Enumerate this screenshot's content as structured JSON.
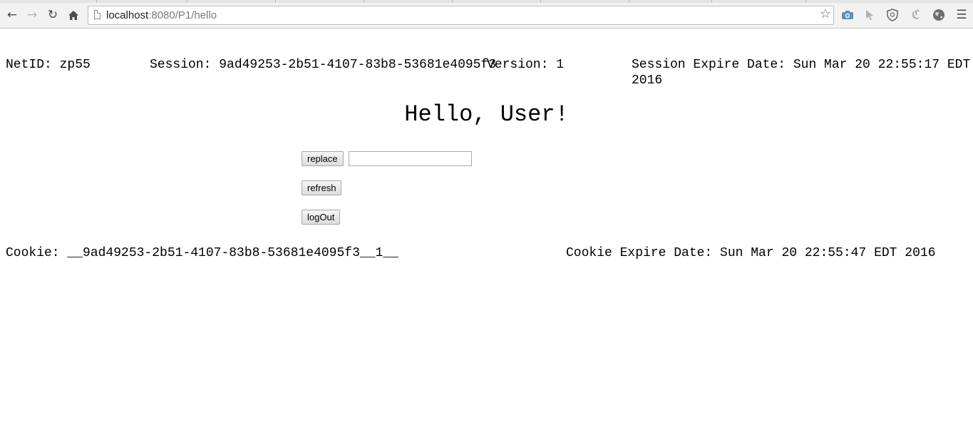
{
  "browser": {
    "url_host": "localhost",
    "url_path": ":8080/P1/hello",
    "icons": {
      "back": "arrow-left-icon",
      "forward": "arrow-right-icon",
      "reload": "reload-icon",
      "home": "home-icon",
      "bookmark": "star-icon",
      "extensions": [
        "camera-icon",
        "cursor-icon",
        "shield-icon",
        "c-icon",
        "globe-icon",
        "menu-icon"
      ]
    }
  },
  "session_info": {
    "netid": "NetID: zp55",
    "session": "Session: 9ad49253-2b51-4107-83b8-53681e4095f3",
    "version": "Version: 1",
    "expire_line1": "Session Expire Date: Sun Mar 20 22:55:17 EDT",
    "expire_line2": "2016"
  },
  "greeting": "Hello, User!",
  "controls": {
    "replace_label": "replace",
    "replace_value": "",
    "refresh_label": "refresh",
    "logout_label": "logOut"
  },
  "cookie_info": {
    "cookie": "Cookie: __9ad49253-2b51-4107-83b8-53681e4095f3__1__",
    "cookie_expire": "Cookie Expire Date: Sun Mar 20 22:55:47 EDT 2016"
  }
}
